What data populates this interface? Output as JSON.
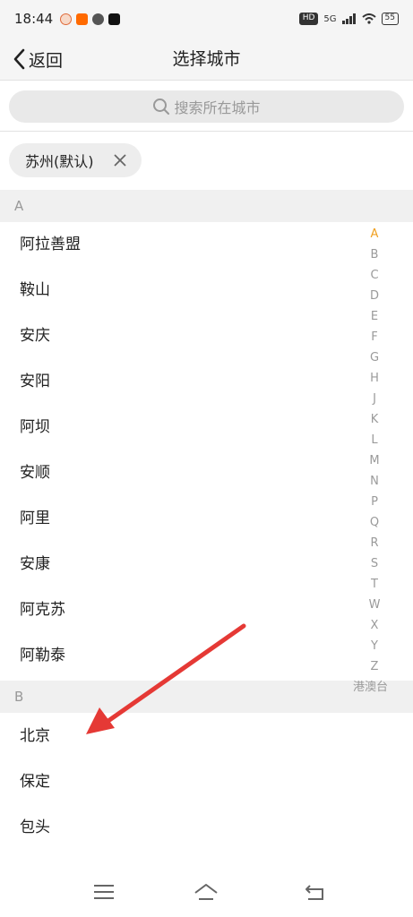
{
  "status_bar": {
    "time": "18:44",
    "network": "5G",
    "hd": "HD",
    "battery": "55"
  },
  "header": {
    "back_label": "返回",
    "title": "选择城市"
  },
  "search": {
    "placeholder": "搜索所在城市"
  },
  "current_city": {
    "label": "苏州(默认)"
  },
  "sections": [
    {
      "letter": "A",
      "cities": [
        "阿拉善盟",
        "鞍山",
        "安庆",
        "安阳",
        "阿坝",
        "安顺",
        "阿里",
        "安康",
        "阿克苏",
        "阿勒泰"
      ]
    },
    {
      "letter": "B",
      "cities": [
        "北京",
        "保定",
        "包头"
      ]
    }
  ],
  "index_bar": {
    "letters": [
      "A",
      "B",
      "C",
      "D",
      "E",
      "F",
      "G",
      "H",
      "J",
      "K",
      "L",
      "M",
      "N",
      "P",
      "Q",
      "R",
      "S",
      "T",
      "W",
      "X",
      "Y",
      "Z"
    ],
    "active": "A",
    "extra": "港澳台"
  },
  "colors": {
    "accent_index": "#f0a020",
    "annotation_arrow": "#e53935"
  },
  "icons": {
    "back": "chevron-left-icon",
    "search": "search-icon",
    "chip_close": "close-icon",
    "nav_menu": "menu-icon",
    "nav_home": "home-icon",
    "nav_back": "back-icon"
  }
}
